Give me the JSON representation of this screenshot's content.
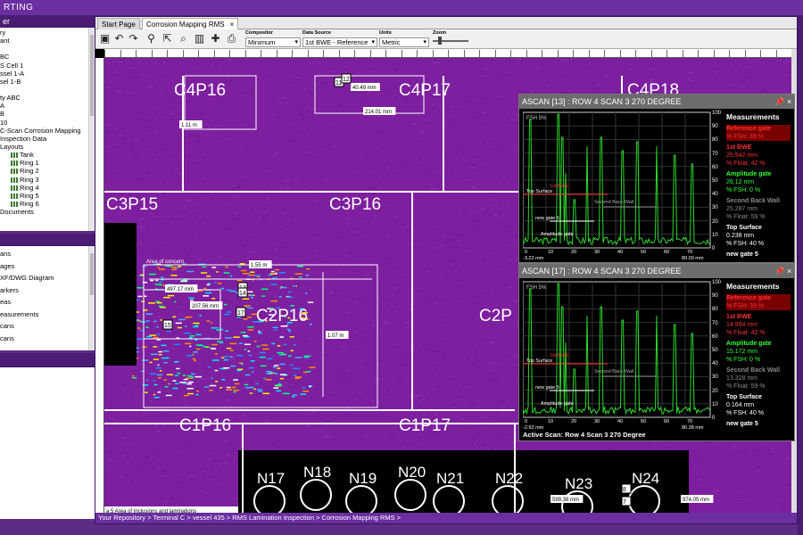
{
  "app": {
    "title": "RTING"
  },
  "left": {
    "panel1_header": "er",
    "tree": [
      {
        "label": "ry",
        "bars": false
      },
      {
        "label": "ant",
        "bars": false
      },
      {
        "label": "",
        "bars": false
      },
      {
        "label": "BC",
        "bars": false
      },
      {
        "label": "S Cell 1",
        "bars": false
      },
      {
        "label": "ssel 1-A",
        "bars": false
      },
      {
        "label": "sel 1-B",
        "bars": false
      },
      {
        "label": "",
        "bars": false
      },
      {
        "label": "ty ABC",
        "bars": false
      },
      {
        "label": "A",
        "bars": false
      },
      {
        "label": "B",
        "bars": false
      },
      {
        "label": "10",
        "bars": false
      },
      {
        "label": "C-Scan Corrosion Mapping",
        "bars": false
      },
      {
        "label": "Inspection Data",
        "bars": false
      },
      {
        "label": "Layouts",
        "bars": false
      },
      {
        "label": "Tank",
        "bars": true
      },
      {
        "label": "Ring 1",
        "bars": true
      },
      {
        "label": "Ring 2",
        "bars": true
      },
      {
        "label": "Ring 3",
        "bars": true
      },
      {
        "label": "Ring 4",
        "bars": true
      },
      {
        "label": "Ring 5",
        "bars": true
      },
      {
        "label": "Ring 6",
        "bars": true
      },
      {
        "label": "Documents",
        "bars": false
      }
    ],
    "list2": [
      "ans",
      "ages",
      "XF/DWG Diagram",
      "arkers",
      "eas",
      "easurements",
      "cans",
      "cans"
    ]
  },
  "tabs": [
    {
      "label": "Start Page"
    },
    {
      "label": "Corrosion Mapping RMS",
      "close": "×"
    }
  ],
  "toolbar": {
    "icons": [
      "save-icon",
      "undo-icon",
      "redo-icon",
      "marker-icon",
      "export-icon",
      "zoom-icon",
      "ruler-icon",
      "crosshair-icon",
      "print-icon"
    ],
    "compositor": {
      "label": "Compositor",
      "value": "Minimum"
    },
    "datasource": {
      "label": "Data Source",
      "value": "1st BWE - Reference oz"
    },
    "units": {
      "label": "Units",
      "value": "Metric"
    },
    "zoom": {
      "label": "Zoom",
      "value": 0.15
    }
  },
  "plates": [
    "C4P16",
    "C4P17",
    "C4P18",
    "C3P15",
    "C3P16",
    "C2P16",
    "C2P",
    "C1P16",
    "C1P17"
  ],
  "nozzles": [
    "N17",
    "N18",
    "N19",
    "N20",
    "N21",
    "N22",
    "N23",
    "N24"
  ],
  "annotations": {
    "area_label": "Area of concern",
    "bottom_note": "a 5 Area of Inclusions and laminations",
    "dims": [
      "1.11 m",
      "40.49 mm",
      "214.01 mm",
      "1.55 m",
      "497.17 mm",
      "207.56 mm",
      "1.07 m",
      "599.38 mm",
      "974.05 mm"
    ],
    "markers": [
      "11",
      "12",
      "13",
      "14",
      "15",
      "17",
      "8",
      "7"
    ]
  },
  "ascans": [
    {
      "title": "ASCAN [13] : ROW 4 SCAN 3 270 DEGREE",
      "xstart": "-3.22 mm",
      "xend": "80.00 mm",
      "labels": {
        "top": "Top Surface",
        "bwe": "1st BWE",
        "second": "Second Back Wall",
        "gate": "new gate 5",
        "amp": "Amplitude gate"
      },
      "measurements": [
        {
          "name": "Reference gate",
          "val": "% FSH: 39 %",
          "col": "#ff3030",
          "bg": "#7a0000"
        },
        {
          "name": "1st BWE",
          "val": "25.942 mm",
          "val2": "% Float: 42 %",
          "col": "#ff3030",
          "bg": ""
        },
        {
          "name": "Amplitude gate",
          "val": "26.12 mm",
          "val2": "% FSH: 0 %",
          "col": "#30ff30",
          "bg": ""
        },
        {
          "name": "Second Back Wall",
          "val": "25.287 mm",
          "val2": "% Float: 59 %",
          "col": "#888888",
          "bg": ""
        },
        {
          "name": "Top Surface",
          "val": "0.238 mm",
          "val2": "% FSH: 40 %",
          "col": "#ffffff",
          "bg": ""
        },
        {
          "name": "new gate 5",
          "val": "",
          "col": "#ffffff",
          "bg": ""
        }
      ]
    },
    {
      "title": "ASCAN [17] : ROW 4 SCAN 3 270 DEGREE",
      "xstart": "-2.92 mm",
      "xend": "80.38 mm",
      "labels": {
        "top": "Top Surface",
        "bwe": "1st BWE",
        "second": "Second Back Wall",
        "gate": "new gate 5",
        "amp": "Amplitude gate"
      },
      "measurements": [
        {
          "name": "Reference gate",
          "val": "% FSH: 39 %",
          "col": "#ff3030",
          "bg": "#7a0000"
        },
        {
          "name": "1st BWE",
          "val": "14.994 mm",
          "val2": "% Float: 42 %",
          "col": "#ff3030",
          "bg": ""
        },
        {
          "name": "Amplitude gate",
          "val": "15.172 mm",
          "val2": "% FSH: 0 %",
          "col": "#30ff30",
          "bg": ""
        },
        {
          "name": "Second Back Wall",
          "val": "13.328 mm",
          "val2": "% Float: 59 %",
          "col": "#888888",
          "bg": ""
        },
        {
          "name": "Top Surface",
          "val": "0.164 mm",
          "val2": "% FSH: 40 %",
          "col": "#ffffff",
          "bg": ""
        },
        {
          "name": "new gate 5",
          "val": "",
          "col": "#ffffff",
          "bg": ""
        }
      ],
      "active_scan": "Active Scan:   Row 4 Scan 3 270 Degree"
    }
  ],
  "ascan_axis": {
    "yticks": [
      "100",
      "90",
      "80",
      "70",
      "60",
      "50",
      "40",
      "30",
      "20",
      "10",
      "0"
    ],
    "xticks": [
      "0",
      "10",
      "20",
      "30",
      "40",
      "50",
      "60",
      "70"
    ],
    "fsh_label": "FSH 5%"
  },
  "measurements_title": "Measurements",
  "breadcrumb": "Your Repository > Terminal C > vessel 435 > RMS Lamination Inspection > Corrosion Mapping RMS >"
}
